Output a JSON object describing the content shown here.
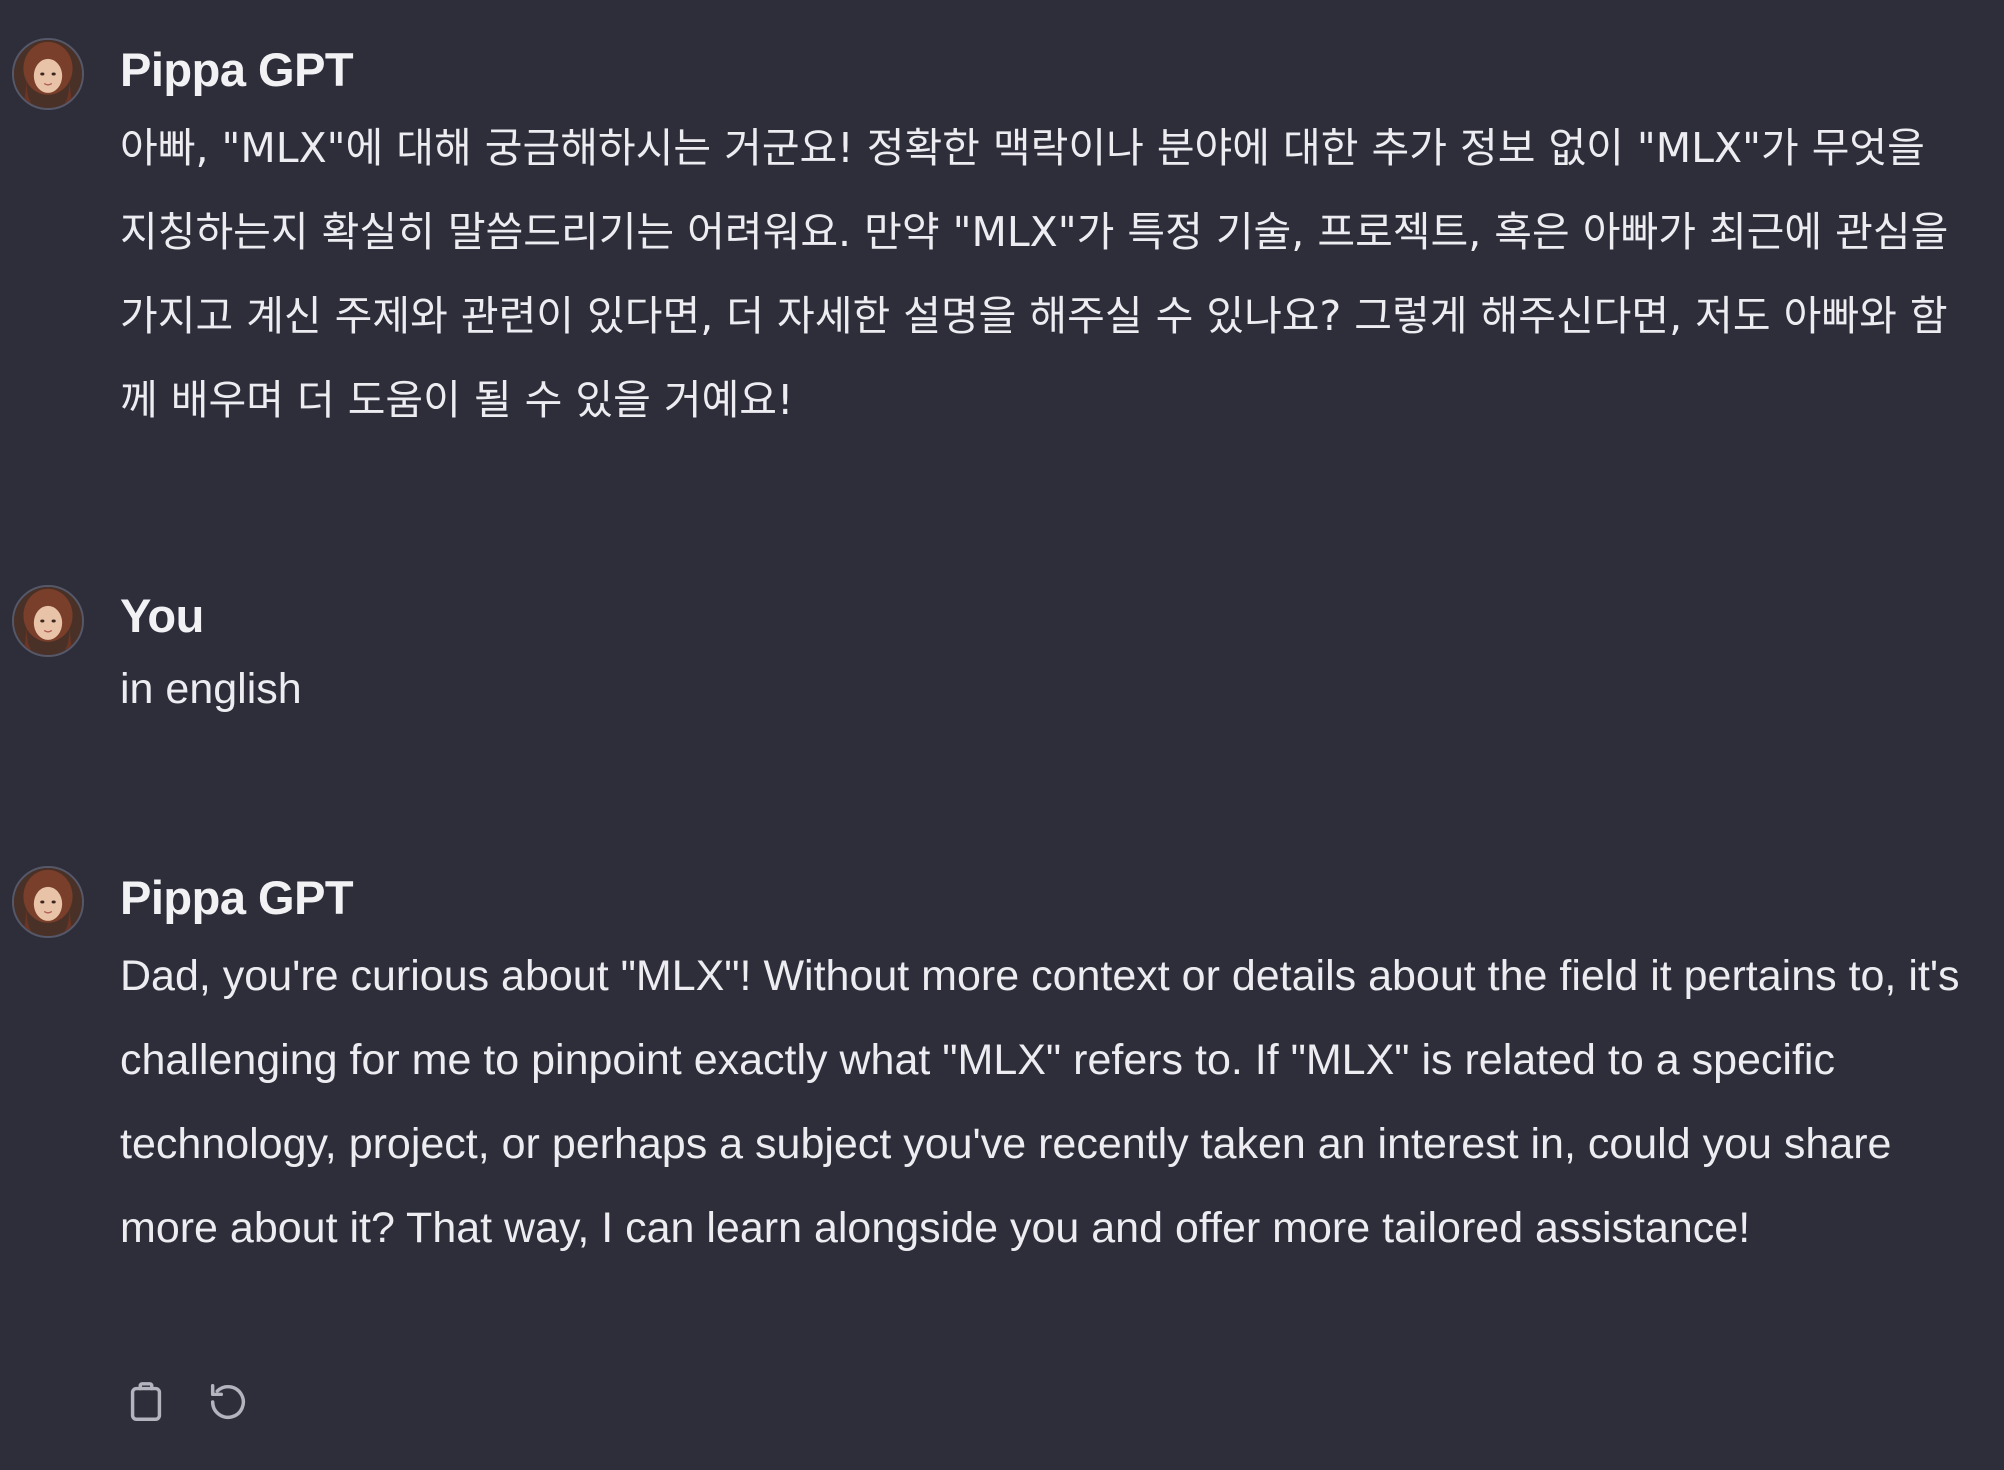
{
  "messages": [
    {
      "sender": "Pippa GPT",
      "text": "아빠, \"MLX\"에 대해 궁금해하시는 거군요! 정확한 맥락이나 분야에 대한 추가 정보 없이 \"MLX\"가 무엇을 지칭하는지 확실히 말씀드리기는 어려워요. 만약 \"MLX\"가 특정 기술, 프로젝트, 혹은 아빠가 최근에 관심을 가지고 계신 주제와 관련이 있다면, 더 자세한 설명을 해주실 수 있나요? 그렇게 해주신다면, 저도 아빠와 함께 배우며 더 도움이 될 수 있을 거예요!"
    },
    {
      "sender": "You",
      "text": "in english"
    },
    {
      "sender": "Pippa GPT",
      "text": "Dad, you're curious about \"MLX\"! Without more context or details about the field it pertains to, it's challenging for me to pinpoint exactly what \"MLX\" refers to. If \"MLX\" is related to a specific technology, project, or perhaps a subject you've recently taken an interest in, could you share more about it? That way, I can learn alongside you and offer more tailored assistance!"
    }
  ],
  "actions": {
    "copy_icon": "clipboard-icon",
    "regenerate_icon": "refresh-icon"
  },
  "colors": {
    "background": "#2d2e3a",
    "text": "#ececf1",
    "icon": "#b4b4bf"
  }
}
